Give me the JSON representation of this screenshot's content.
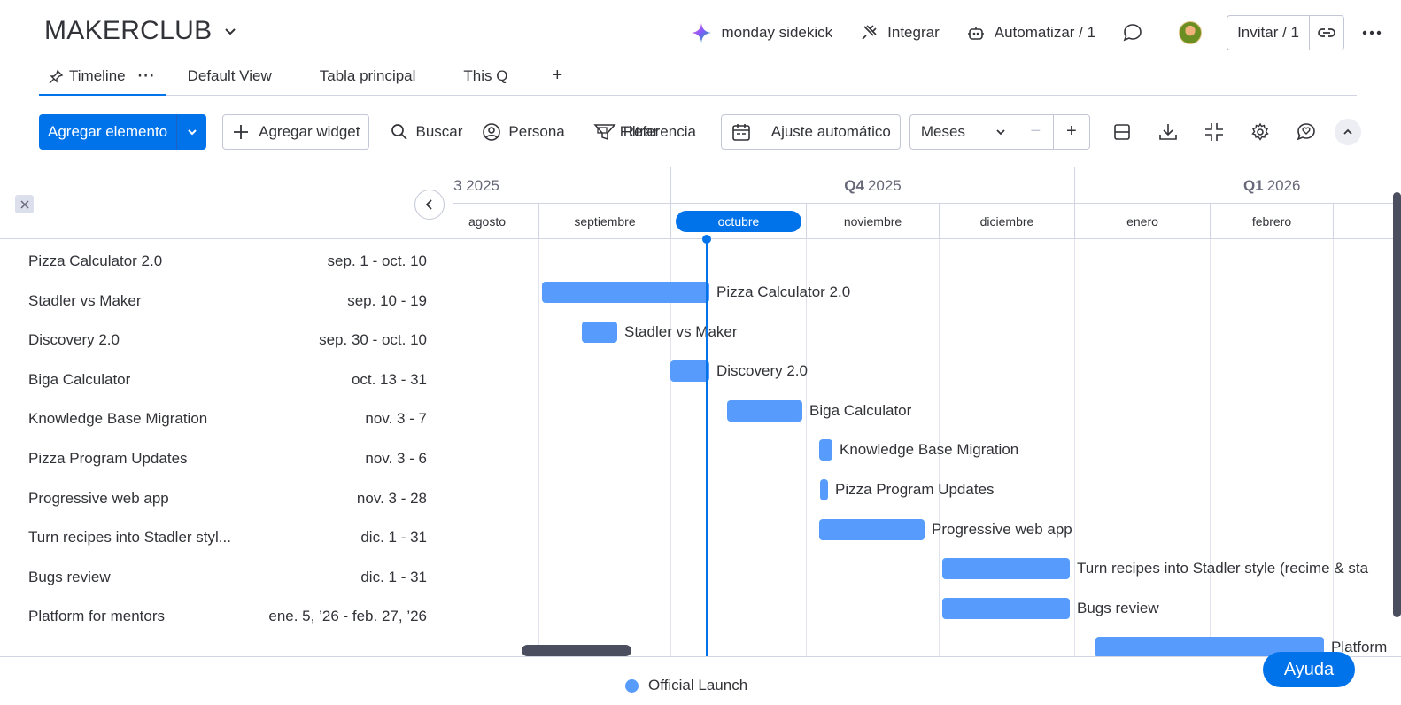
{
  "board": {
    "title": "MAKERCLUB"
  },
  "header": {
    "sidekick": "monday sidekick",
    "integrate": "Integrar",
    "automate": "Automatizar / 1",
    "invite": "Invitar / 1"
  },
  "tabs": [
    {
      "label": "Timeline",
      "more": "···"
    },
    {
      "label": "Default View"
    },
    {
      "label": "Tabla principal"
    },
    {
      "label": "This Q"
    },
    {
      "label": "+"
    }
  ],
  "toolbar": {
    "add_item": "Agregar elemento",
    "add_widget": "Agregar widget",
    "search": "Buscar",
    "person": "Persona",
    "filter": "Filtrar",
    "reference": "Referencia",
    "auto_fit": "Ajuste automático",
    "scale": "Meses",
    "zoom_out": "−",
    "zoom_in": "+"
  },
  "timeline": {
    "quarters": [
      {
        "q": "",
        "year": "3 2025"
      },
      {
        "q": "Q4",
        "year": "2025"
      },
      {
        "q": "Q1",
        "year": "2026"
      }
    ],
    "months": [
      "agosto",
      "septiembre",
      "octubre",
      "noviembre",
      "diciembre",
      "enero",
      "febrero"
    ],
    "current_month": "octubre"
  },
  "items": [
    {
      "name": "Pizza Calculator 2.0",
      "dates": "sep. 1 - oct. 10",
      "label": "Pizza Calculator 2.0"
    },
    {
      "name": "Stadler vs Maker",
      "dates": "sep. 10 - 19",
      "label": "Stadler vs Maker"
    },
    {
      "name": "Discovery 2.0",
      "dates": "sep. 30 - oct. 10",
      "label": "Discovery 2.0"
    },
    {
      "name": "Biga Calculator",
      "dates": "oct. 13 - 31",
      "label": "Biga Calculator"
    },
    {
      "name": "Knowledge Base Migration",
      "dates": "nov. 3 - 7",
      "label": "Knowledge Base Migration"
    },
    {
      "name": "Pizza Program Updates",
      "dates": "nov. 3 - 6",
      "label": "Pizza Program Updates"
    },
    {
      "name": "Progressive web app",
      "dates": "nov. 3 - 28",
      "label": "Progressive web app"
    },
    {
      "name": "Turn recipes into Stadler styl...",
      "dates": "dic. 1 - 31",
      "label": "Turn recipes into Stadler style (recime & sta"
    },
    {
      "name": "Bugs review",
      "dates": "dic. 1 - 31",
      "label": "Bugs review"
    },
    {
      "name": "Platform for mentors",
      "dates": "ene. 5, ’26 - feb. 27, ’26",
      "label": "Platform"
    }
  ],
  "legend": {
    "label": "Official Launch",
    "color": "#579bfc"
  },
  "help": {
    "label": "Ayuda"
  },
  "colors": {
    "accent": "#0073ea",
    "bar": "#579bfc"
  }
}
